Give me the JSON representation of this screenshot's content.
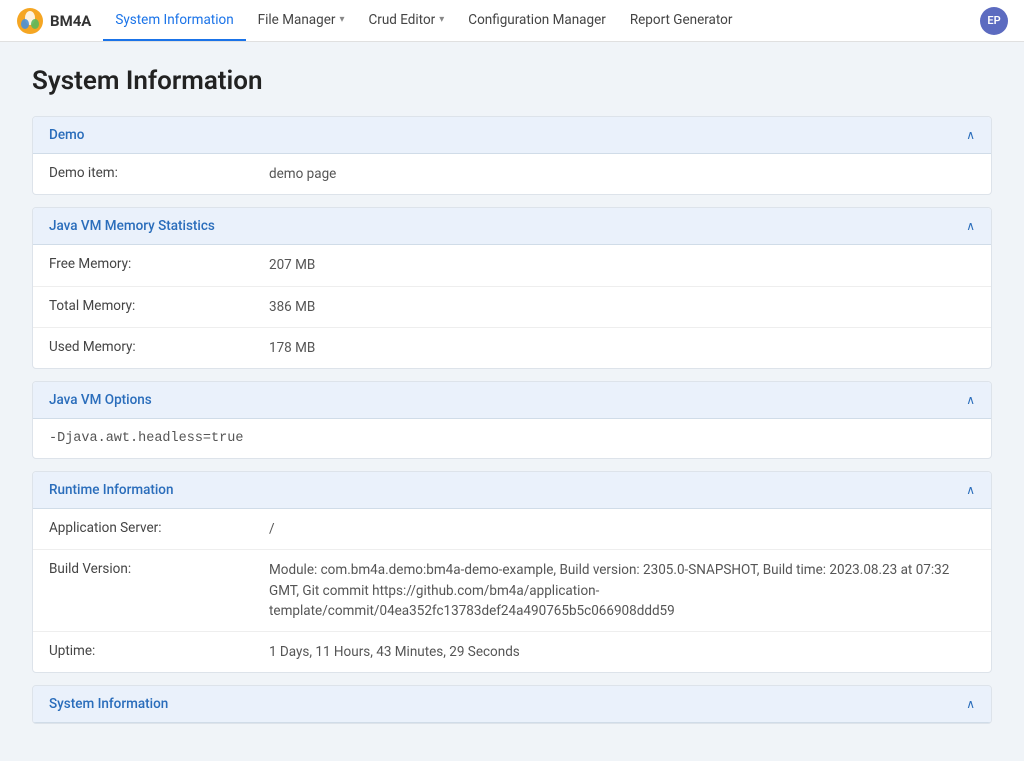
{
  "navbar": {
    "logo_text": "BM4A",
    "avatar_initials": "EP",
    "items": [
      {
        "label": "System Information",
        "active": true,
        "has_dropdown": false
      },
      {
        "label": "File Manager",
        "active": false,
        "has_dropdown": true
      },
      {
        "label": "Crud Editor",
        "active": false,
        "has_dropdown": true
      },
      {
        "label": "Configuration Manager",
        "active": false,
        "has_dropdown": false
      },
      {
        "label": "Report Generator",
        "active": false,
        "has_dropdown": false
      }
    ]
  },
  "page": {
    "title": "System Information"
  },
  "sections": [
    {
      "id": "demo",
      "title": "Demo",
      "collapsed": false,
      "type": "rows",
      "rows": [
        {
          "label": "Demo item:",
          "value": "demo page"
        }
      ]
    },
    {
      "id": "jvm-memory",
      "title": "Java VM Memory Statistics",
      "collapsed": false,
      "type": "rows",
      "rows": [
        {
          "label": "Free Memory:",
          "value": "207 MB"
        },
        {
          "label": "Total Memory:",
          "value": "386 MB"
        },
        {
          "label": "Used Memory:",
          "value": "178 MB"
        }
      ]
    },
    {
      "id": "jvm-options",
      "title": "Java VM Options",
      "collapsed": false,
      "type": "plain",
      "content": "-Djava.awt.headless=true"
    },
    {
      "id": "runtime",
      "title": "Runtime Information",
      "collapsed": false,
      "type": "rows",
      "rows": [
        {
          "label": "Application Server:",
          "value": "/"
        },
        {
          "label": "Build Version:",
          "value": "Module: com.bm4a.demo:bm4a-demo-example, Build version: 2305.0-SNAPSHOT, Build time: 2023.08.23 at 07:32 GMT, Git commit https://github.com/bm4a/application-template/commit/04ea352fc13783def24a490765b5c066908ddd59"
        },
        {
          "label": "Uptime:",
          "value": "1 Days, 11 Hours, 43 Minutes, 29 Seconds"
        }
      ]
    },
    {
      "id": "system-info",
      "title": "System Information",
      "collapsed": false,
      "type": "rows",
      "rows": []
    }
  ]
}
